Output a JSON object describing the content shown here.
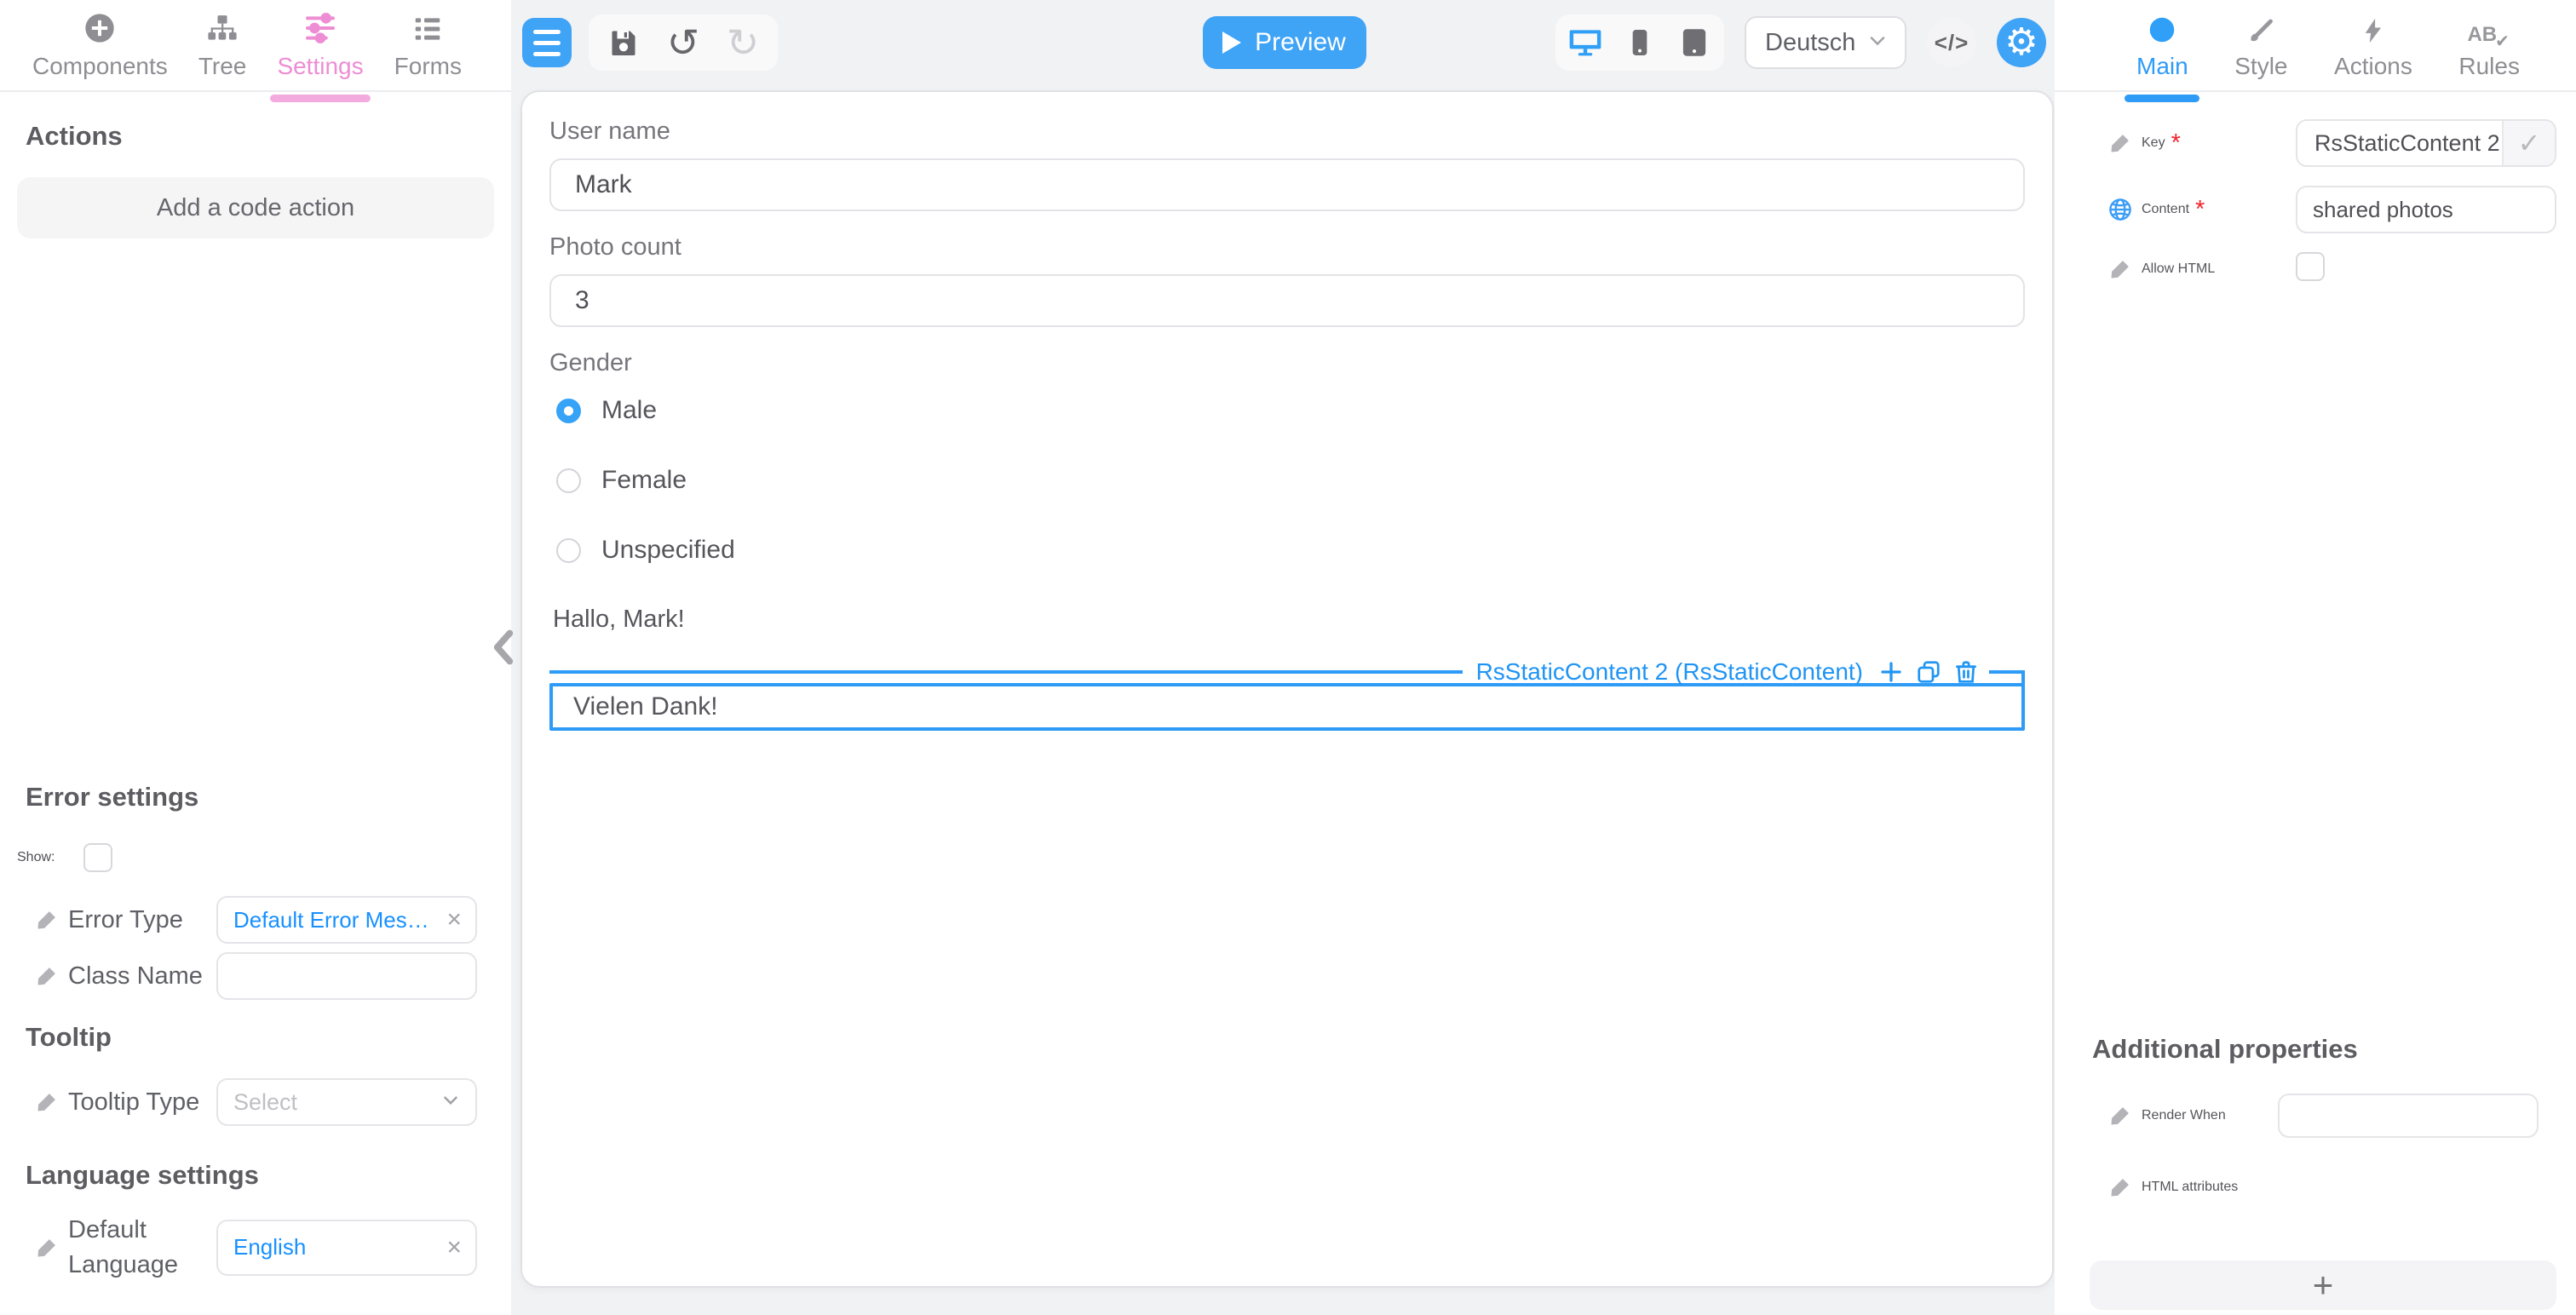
{
  "left_panel": {
    "tabs": [
      {
        "label": "Components",
        "icon": "plus-circle-icon",
        "active": false
      },
      {
        "label": "Tree",
        "icon": "tree-icon",
        "active": false
      },
      {
        "label": "Settings",
        "icon": "sliders-icon",
        "active": true
      },
      {
        "label": "Forms",
        "icon": "list-icon",
        "active": false
      }
    ],
    "actions": {
      "heading": "Actions",
      "add_button": "Add a code action"
    },
    "error_settings": {
      "heading": "Error settings",
      "show_label": "Show:",
      "show_checked": false,
      "error_type_label": "Error Type",
      "error_type_value": "Default Error Mess…",
      "class_name_label": "Class Name",
      "class_name_value": ""
    },
    "tooltip": {
      "heading": "Tooltip",
      "type_label": "Tooltip Type",
      "type_placeholder": "Select"
    },
    "language_settings": {
      "heading": "Language settings",
      "default_language_label": "Default Language",
      "default_language_value": "English"
    }
  },
  "toolbar": {
    "preview_label": "Preview",
    "language_selector_value": "Deutsch",
    "active_device": "desktop"
  },
  "icons": {
    "code": "</>",
    "gear": "⚙",
    "undo": "↺",
    "redo": "↻",
    "check": "✓",
    "clear": "×"
  },
  "canvas": {
    "username_label": "User name",
    "username_value": "Mark",
    "photo_count_label": "Photo count",
    "photo_count_value": "3",
    "gender_label": "Gender",
    "gender_options": [
      {
        "label": "Male",
        "selected": true
      },
      {
        "label": "Female",
        "selected": false
      },
      {
        "label": "Unspecified",
        "selected": false
      }
    ],
    "greeting_text": "Hallo, Mark!",
    "selected_component": {
      "label": "RsStaticContent 2 (RsStaticContent)",
      "content": "Vielen Dank!",
      "type": "RsStaticContent"
    }
  },
  "right_panel": {
    "tabs": [
      {
        "label": "Main",
        "icon": "circle-icon",
        "active": true
      },
      {
        "label": "Style",
        "icon": "brush-icon",
        "active": false
      },
      {
        "label": "Actions",
        "icon": "bolt-icon",
        "active": false
      },
      {
        "label": "Rules",
        "icon": "ab-check-icon",
        "active": false
      }
    ],
    "fields": {
      "key_label": "Key",
      "key_required": true,
      "key_value": "RsStaticContent 2",
      "content_label": "Content",
      "content_required": true,
      "content_value": "shared photos",
      "allow_html_label": "Allow HTML",
      "allow_html_checked": false
    },
    "additional_properties": {
      "heading": "Additional properties",
      "render_when_label": "Render When",
      "render_when_value": "",
      "html_attributes_label": "HTML attributes",
      "add_button_label": "+"
    }
  },
  "colors": {
    "accent_blue": "#3fa3f6",
    "selection_blue": "#2e9bf7",
    "link_blue": "#1890ff",
    "active_pink": "#ee8dd3",
    "required_red": "#f5222d"
  }
}
